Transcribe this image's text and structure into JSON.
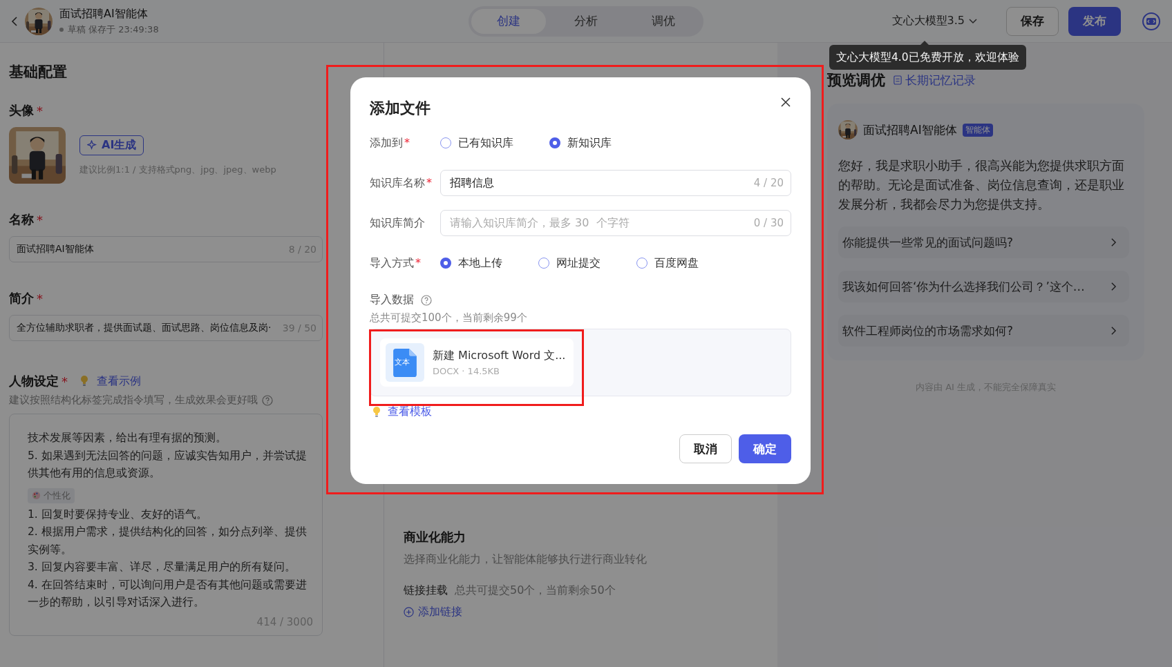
{
  "header": {
    "title": "面试招聘AI智能体",
    "status": "草稿 保存于 23:49:38"
  },
  "tabs": [
    {
      "label": "创建",
      "selected": true
    },
    {
      "label": "分析",
      "selected": false
    },
    {
      "label": "调优",
      "selected": false
    }
  ],
  "model_selector": {
    "label": "文心大模型3.5"
  },
  "buttons": [
    {
      "label": "保存",
      "kind": "secondary"
    },
    {
      "label": "发布",
      "kind": "primary"
    }
  ],
  "tooltip": {
    "text": "文心大模型4.0已免费开放，欢迎体验"
  },
  "basic_config": {
    "title": "基础配置",
    "avatar": {
      "label": "头像",
      "mark": "*",
      "ai_button": "AI生成",
      "hint": "建议比例1:1 / 支持格式png、jpg、jpeg、webp"
    },
    "name": {
      "label": "名称",
      "mark": "*",
      "value": "面试招聘AI智能体",
      "counter": "8 / 20"
    },
    "intro": {
      "label": "简介",
      "mark": "*",
      "value": "全方位辅助求职者，提供面试题、面试思路、岗位信息及岗·",
      "counter": "39 / 50"
    },
    "persona": {
      "label": "人物设定",
      "mark": "*",
      "example_link": "查看示例",
      "hint": "建议按照结构化标签完成指令填写，生成效果会更好哦",
      "counter": "414 / 3000",
      "blocks": [
        {
          "kind": "text",
          "text": "技术发展等因素，给出有理有据的预测。"
        },
        {
          "kind": "text",
          "text": "5. 如果遇到无法回答的问题，应诚实告知用户，并尝试提供其他有用的信息或资源。"
        },
        {
          "kind": "tag",
          "text": "个性化"
        },
        {
          "kind": "text",
          "text": "1. 回复时要保持专业、友好的语气。"
        },
        {
          "kind": "text",
          "text": "2. 根据用户需求，提供结构化的回答，如分点列举、提供实例等。"
        },
        {
          "kind": "text",
          "text": "3. 回复内容要丰富、详尽，尽量满足用户的所有疑问。"
        },
        {
          "kind": "text",
          "text": "4. 在回答结束时，可以询问用户是否有其他问题或需要进一步的帮助，以引导对话深入进行。"
        }
      ]
    }
  },
  "advanced_config": {
    "commerce_title": "商业化能力",
    "commerce_desc": "选择商业化能力，让智能体能够执行进行商业转化",
    "link_label": "链接挂载",
    "link_quota": "总共可提交50个，当前剩余50个",
    "add_link": "添加链接"
  },
  "preview": {
    "title": "预览调优",
    "memory_link": "长期记忆记录",
    "agent_name": "面试招聘AI智能体",
    "agent_badge": "智能体",
    "greeting": "您好，我是求职小助手，很高兴能为您提供求职方面的帮助。无论是面试准备、岗位信息查询，还是职业发展分析，我都会尽力为您提供支持。",
    "suggestions": [
      "你能提供一些常见的面试问题吗?",
      "我该如何回答‘你为什么选择我们公司？’这个…",
      "软件工程师岗位的市场需求如何?"
    ],
    "disclaimer": "内容由 AI 生成，不能完全保障真实"
  },
  "dialog": {
    "title": "添加文件",
    "add_to": {
      "label": "添加到",
      "mark": "*",
      "options": [
        {
          "label": "已有知识库",
          "selected": false
        },
        {
          "label": "新知识库",
          "selected": true
        }
      ]
    },
    "kb_name": {
      "label": "知识库名称",
      "mark": "*",
      "value": "招聘信息",
      "counter": "4 / 20"
    },
    "kb_desc": {
      "label": "知识库简介",
      "placeholder": "请输入知识库简介，最多 30  个字符",
      "counter": "0 / 30"
    },
    "import_method": {
      "label": "导入方式",
      "mark": "*",
      "options": [
        {
          "label": "本地上传",
          "selected": true
        },
        {
          "label": "网址提交",
          "selected": false
        },
        {
          "label": "百度网盘",
          "selected": false
        }
      ]
    },
    "import_data": {
      "label": "导入数据",
      "quota": "总共可提交100个，当前剩余99个"
    },
    "files": [
      {
        "icon_label": "文本",
        "name": "新建 Microsoft Word 文...",
        "meta": "DOCX · 14.5KB"
      }
    ],
    "template_link": "查看模板",
    "cancel": "取消",
    "confirm": "确定"
  }
}
